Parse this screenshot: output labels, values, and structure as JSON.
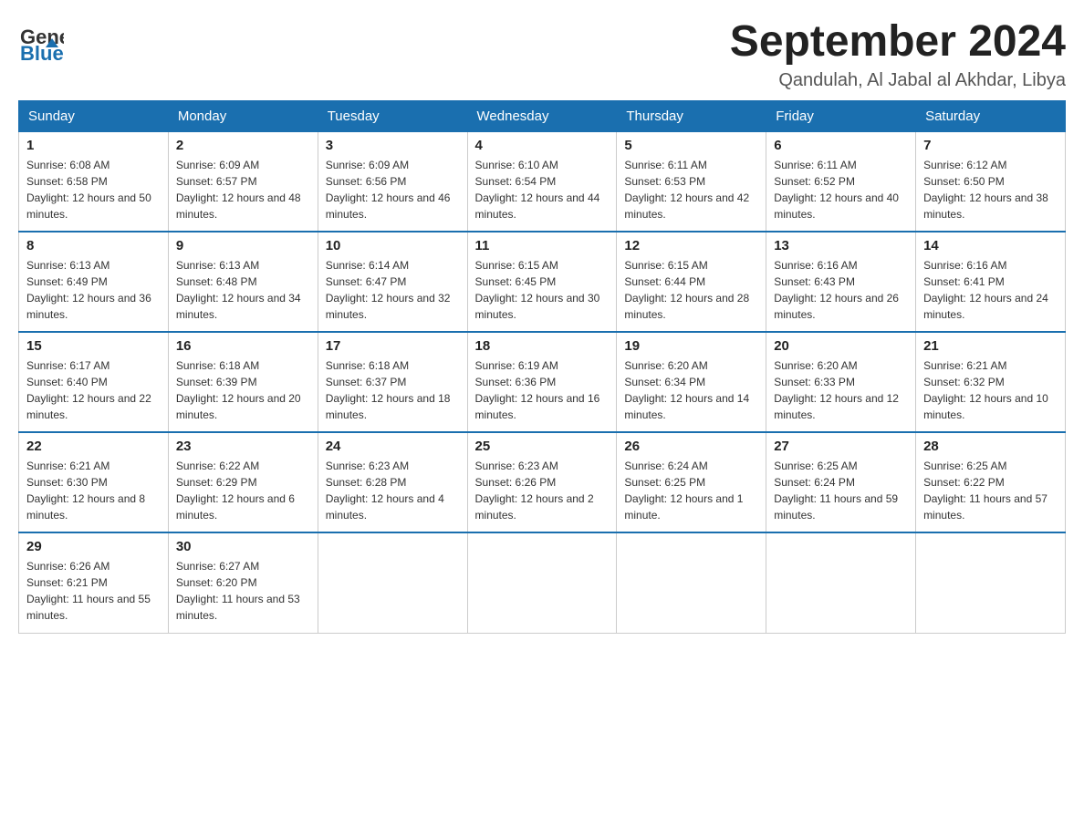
{
  "logo": {
    "general": "General",
    "blue": "Blue"
  },
  "header": {
    "month": "September 2024",
    "location": "Qandulah, Al Jabal al Akhdar, Libya"
  },
  "weekdays": [
    "Sunday",
    "Monday",
    "Tuesday",
    "Wednesday",
    "Thursday",
    "Friday",
    "Saturday"
  ],
  "weeks": [
    [
      {
        "day": "1",
        "sunrise": "6:08 AM",
        "sunset": "6:58 PM",
        "daylight": "12 hours and 50 minutes."
      },
      {
        "day": "2",
        "sunrise": "6:09 AM",
        "sunset": "6:57 PM",
        "daylight": "12 hours and 48 minutes."
      },
      {
        "day": "3",
        "sunrise": "6:09 AM",
        "sunset": "6:56 PM",
        "daylight": "12 hours and 46 minutes."
      },
      {
        "day": "4",
        "sunrise": "6:10 AM",
        "sunset": "6:54 PM",
        "daylight": "12 hours and 44 minutes."
      },
      {
        "day": "5",
        "sunrise": "6:11 AM",
        "sunset": "6:53 PM",
        "daylight": "12 hours and 42 minutes."
      },
      {
        "day": "6",
        "sunrise": "6:11 AM",
        "sunset": "6:52 PM",
        "daylight": "12 hours and 40 minutes."
      },
      {
        "day": "7",
        "sunrise": "6:12 AM",
        "sunset": "6:50 PM",
        "daylight": "12 hours and 38 minutes."
      }
    ],
    [
      {
        "day": "8",
        "sunrise": "6:13 AM",
        "sunset": "6:49 PM",
        "daylight": "12 hours and 36 minutes."
      },
      {
        "day": "9",
        "sunrise": "6:13 AM",
        "sunset": "6:48 PM",
        "daylight": "12 hours and 34 minutes."
      },
      {
        "day": "10",
        "sunrise": "6:14 AM",
        "sunset": "6:47 PM",
        "daylight": "12 hours and 32 minutes."
      },
      {
        "day": "11",
        "sunrise": "6:15 AM",
        "sunset": "6:45 PM",
        "daylight": "12 hours and 30 minutes."
      },
      {
        "day": "12",
        "sunrise": "6:15 AM",
        "sunset": "6:44 PM",
        "daylight": "12 hours and 28 minutes."
      },
      {
        "day": "13",
        "sunrise": "6:16 AM",
        "sunset": "6:43 PM",
        "daylight": "12 hours and 26 minutes."
      },
      {
        "day": "14",
        "sunrise": "6:16 AM",
        "sunset": "6:41 PM",
        "daylight": "12 hours and 24 minutes."
      }
    ],
    [
      {
        "day": "15",
        "sunrise": "6:17 AM",
        "sunset": "6:40 PM",
        "daylight": "12 hours and 22 minutes."
      },
      {
        "day": "16",
        "sunrise": "6:18 AM",
        "sunset": "6:39 PM",
        "daylight": "12 hours and 20 minutes."
      },
      {
        "day": "17",
        "sunrise": "6:18 AM",
        "sunset": "6:37 PM",
        "daylight": "12 hours and 18 minutes."
      },
      {
        "day": "18",
        "sunrise": "6:19 AM",
        "sunset": "6:36 PM",
        "daylight": "12 hours and 16 minutes."
      },
      {
        "day": "19",
        "sunrise": "6:20 AM",
        "sunset": "6:34 PM",
        "daylight": "12 hours and 14 minutes."
      },
      {
        "day": "20",
        "sunrise": "6:20 AM",
        "sunset": "6:33 PM",
        "daylight": "12 hours and 12 minutes."
      },
      {
        "day": "21",
        "sunrise": "6:21 AM",
        "sunset": "6:32 PM",
        "daylight": "12 hours and 10 minutes."
      }
    ],
    [
      {
        "day": "22",
        "sunrise": "6:21 AM",
        "sunset": "6:30 PM",
        "daylight": "12 hours and 8 minutes."
      },
      {
        "day": "23",
        "sunrise": "6:22 AM",
        "sunset": "6:29 PM",
        "daylight": "12 hours and 6 minutes."
      },
      {
        "day": "24",
        "sunrise": "6:23 AM",
        "sunset": "6:28 PM",
        "daylight": "12 hours and 4 minutes."
      },
      {
        "day": "25",
        "sunrise": "6:23 AM",
        "sunset": "6:26 PM",
        "daylight": "12 hours and 2 minutes."
      },
      {
        "day": "26",
        "sunrise": "6:24 AM",
        "sunset": "6:25 PM",
        "daylight": "12 hours and 1 minute."
      },
      {
        "day": "27",
        "sunrise": "6:25 AM",
        "sunset": "6:24 PM",
        "daylight": "11 hours and 59 minutes."
      },
      {
        "day": "28",
        "sunrise": "6:25 AM",
        "sunset": "6:22 PM",
        "daylight": "11 hours and 57 minutes."
      }
    ],
    [
      {
        "day": "29",
        "sunrise": "6:26 AM",
        "sunset": "6:21 PM",
        "daylight": "11 hours and 55 minutes."
      },
      {
        "day": "30",
        "sunrise": "6:27 AM",
        "sunset": "6:20 PM",
        "daylight": "11 hours and 53 minutes."
      },
      null,
      null,
      null,
      null,
      null
    ]
  ]
}
